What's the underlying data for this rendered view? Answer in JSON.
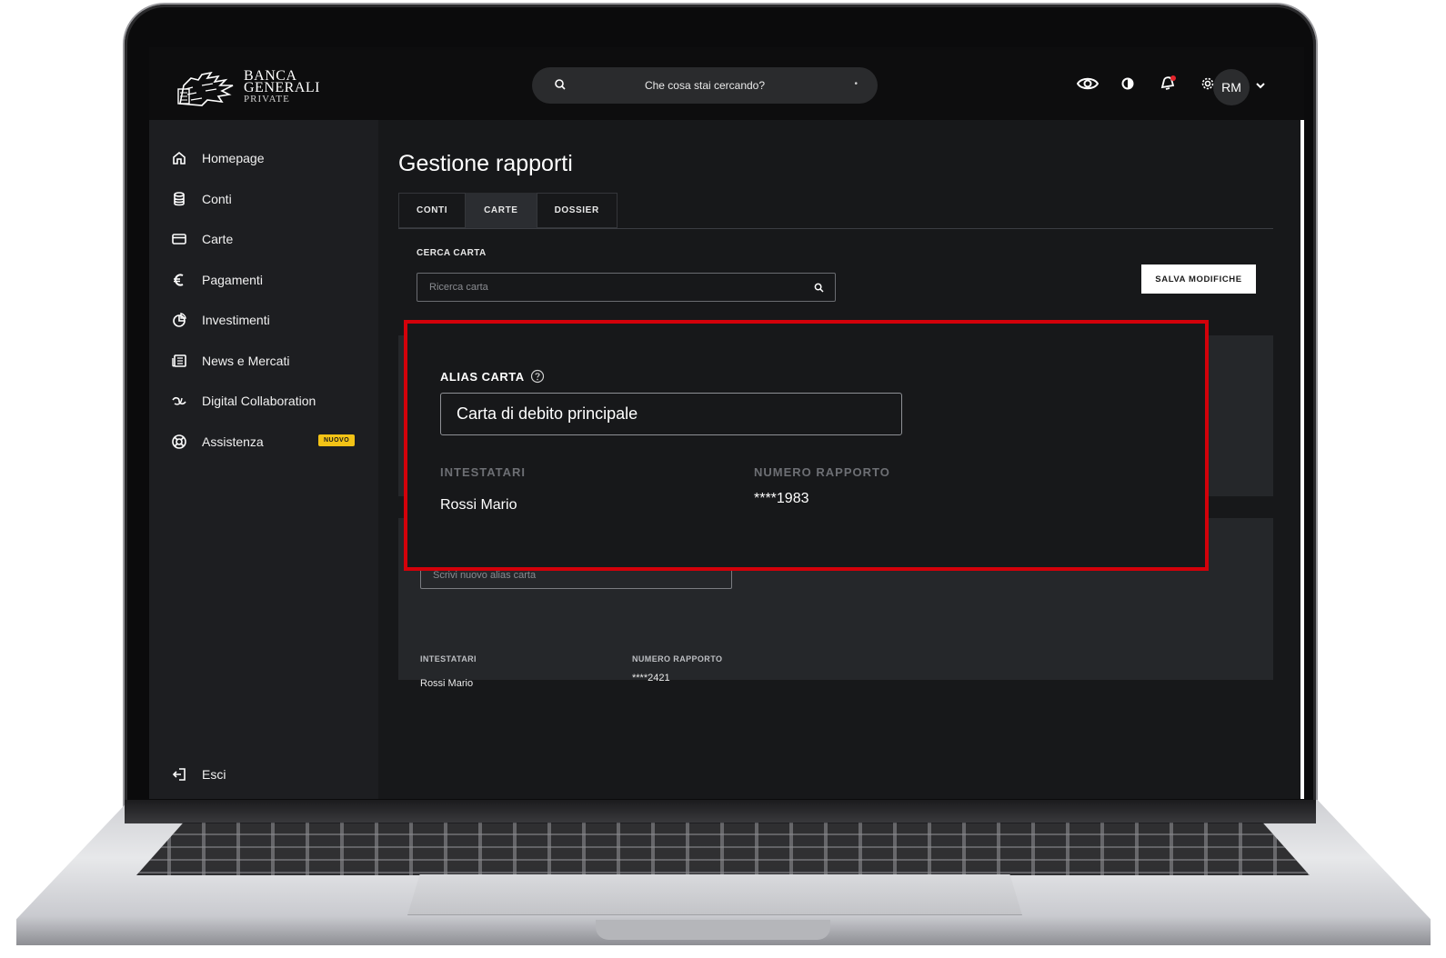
{
  "brand": {
    "line1": "BANCA",
    "line2": "GENERALI",
    "line3": "PRIVATE"
  },
  "header": {
    "search_placeholder": "Che cosa stai cercando?",
    "avatar_initials": "RM",
    "icons": [
      "search-icon",
      "eye-icon",
      "contrast-icon",
      "notification-bell-icon",
      "gear-icon",
      "chevron-down-icon"
    ]
  },
  "sidebar": {
    "items": [
      {
        "label": "Homepage",
        "icon": "home-icon"
      },
      {
        "label": "Conti",
        "icon": "database-icon"
      },
      {
        "label": "Carte",
        "icon": "card-icon"
      },
      {
        "label": "Pagamenti",
        "icon": "euro-icon"
      },
      {
        "label": "Investimenti",
        "icon": "pie-chart-icon"
      },
      {
        "label": "News e Mercati",
        "icon": "newspaper-icon"
      },
      {
        "label": "Digital Collaboration",
        "icon": "collaboration-icon"
      },
      {
        "label": "Assistenza",
        "icon": "lifebuoy-icon",
        "badge": "NUOVO"
      }
    ],
    "logout_label": "Esci"
  },
  "main": {
    "title": "Gestione rapporti",
    "tabs": [
      {
        "label": "CONTI",
        "active": false
      },
      {
        "label": "CARTE",
        "active": true
      },
      {
        "label": "DOSSIER",
        "active": false
      }
    ],
    "search_label": "CERCA CARTA",
    "search_placeholder": "Ricerca carta",
    "save_button": "SALVA MODIFICHE",
    "card_b": {
      "alias_placeholder": "Scrivi nuovo alias carta",
      "holders_label": "INTESTATARI",
      "holders_value": "Rossi Mario",
      "number_label": "NUMERO RAPPORTO",
      "number_value": "****2421"
    }
  },
  "highlight": {
    "alias_label": "ALIAS CARTA",
    "alias_value": "Carta di debito principale",
    "holders_label": "INTESTATARI",
    "holders_value": "Rossi Mario",
    "number_label": "NUMERO RAPPORTO",
    "number_value": "****1983"
  },
  "colors": {
    "accent_red": "#d3010a",
    "badge_yellow": "#f3c316",
    "notification_dot": "#e5242b"
  }
}
